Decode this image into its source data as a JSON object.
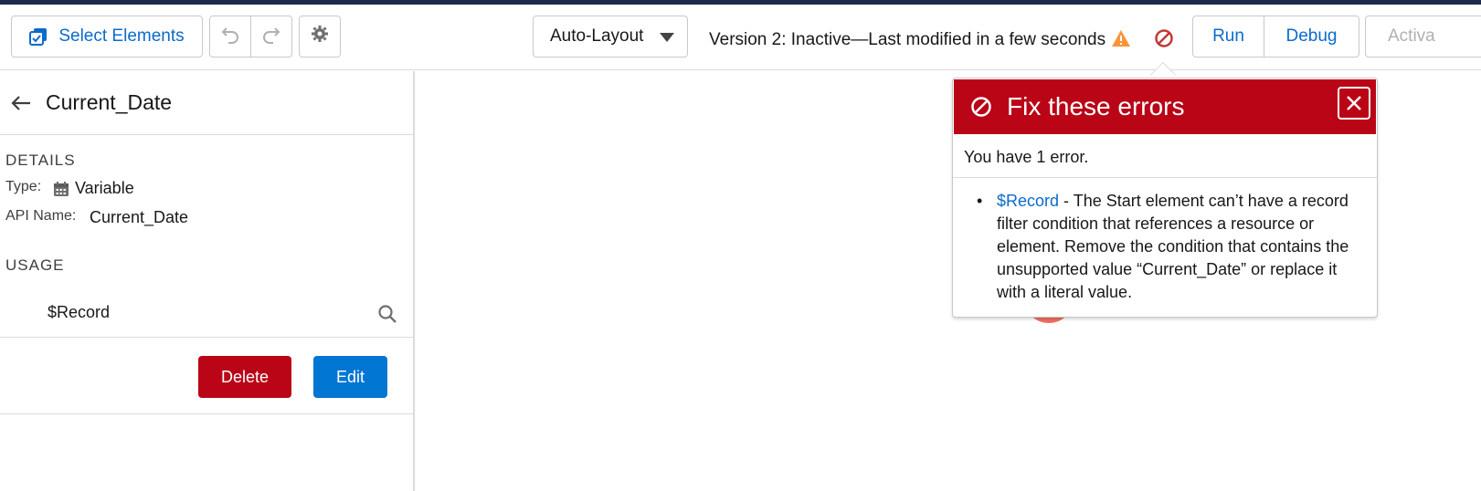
{
  "toolbar": {
    "select_elements": "Select Elements",
    "layout_mode": "Auto-Layout",
    "version_status": "Version 2: Inactive—Last modified in a few seconds",
    "run": "Run",
    "debug": "Debug",
    "activate": "Activa"
  },
  "sidebar": {
    "title": "Current_Date",
    "details_label": "DETAILS",
    "type_label": "Type:",
    "type_value": "Variable",
    "api_name_label": "API Name:",
    "api_name_value": "Current_Date",
    "usage_label": "USAGE",
    "usage_item": "$Record",
    "delete": "Delete",
    "edit": "Edit"
  },
  "error_popover": {
    "title": "Fix these errors",
    "count_text": "You have 1 error.",
    "error_link": "$Record",
    "error_message": " - The Start element can’t have a record filter condition that references a resource or element. Remove the condition that contains the unsupported value “Current_Date” or replace it with a literal value."
  },
  "colors": {
    "brand_blue": "#0176d3",
    "error_red": "#ba0517",
    "warning_orange": "#fe9339",
    "link_blue": "#0b6bcb"
  },
  "icons": [
    "select-elements-icon",
    "undo-icon",
    "redo-icon",
    "gear-icon",
    "chevron-down-icon",
    "warning-icon",
    "error-icon",
    "back-arrow-icon",
    "calendar-icon",
    "search-icon",
    "close-icon"
  ]
}
